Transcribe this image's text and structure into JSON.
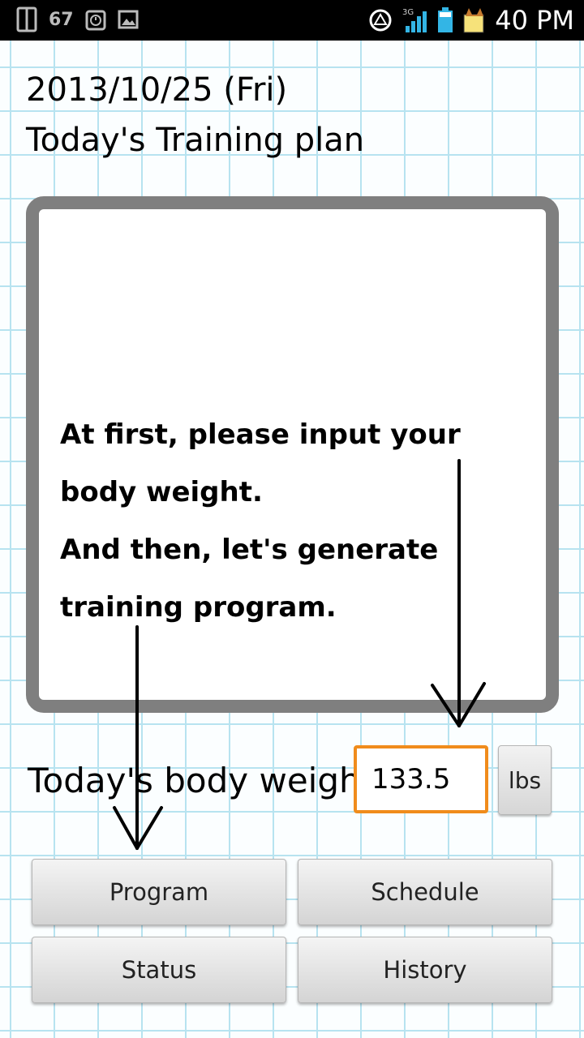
{
  "status_bar": {
    "signal_text": "67",
    "time": "40 PM",
    "network": "3G"
  },
  "header": {
    "date": "2013/10/25 (Fri)",
    "title": "Today's Training plan"
  },
  "message": {
    "lines": [
      "At first, please input your",
      "body weight.",
      "And then, let's generate",
      "training program."
    ]
  },
  "weight": {
    "label": "Today's body weight",
    "value": "133.5",
    "unit": "lbs"
  },
  "buttons": {
    "program": "Program",
    "schedule": "Schedule",
    "status": "Status",
    "history": "History"
  },
  "colors": {
    "grid": "#b7e3f0",
    "panel_border": "#7f7f7f",
    "input_focus": "#f08c1c"
  }
}
